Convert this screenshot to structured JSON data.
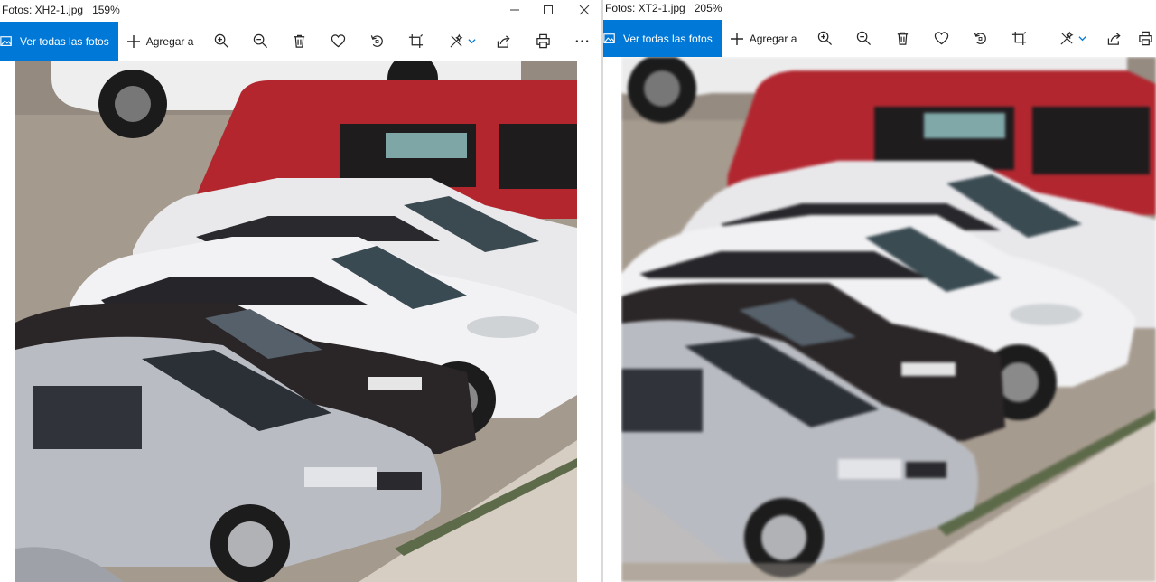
{
  "windows": [
    {
      "title": "Fotos: XH2-1.jpg",
      "zoom": "159%",
      "toolbar": {
        "see_all_label": "Ver todas las fotos",
        "add_to_label": "Agregar a"
      }
    },
    {
      "title": "Fotos: XT2-1.jpg",
      "zoom": "205%",
      "toolbar": {
        "see_all_label": "Ver todas las fotos",
        "add_to_label": "Agregar a"
      }
    }
  ],
  "colors": {
    "accent": "#0078d7",
    "toolbar_bg": "#ffffff",
    "icon": "#262626"
  },
  "icons": {
    "toolbar": [
      "photos-icon",
      "plus-icon",
      "zoom-in-icon",
      "zoom-out-icon",
      "trash-icon",
      "heart-icon",
      "rotate-icon",
      "crop-icon",
      "enhance-icon",
      "chevron-down-icon",
      "share-icon",
      "print-icon",
      "more-icon"
    ],
    "window_controls": [
      "minimize-icon",
      "maximize-icon",
      "close-icon"
    ]
  }
}
